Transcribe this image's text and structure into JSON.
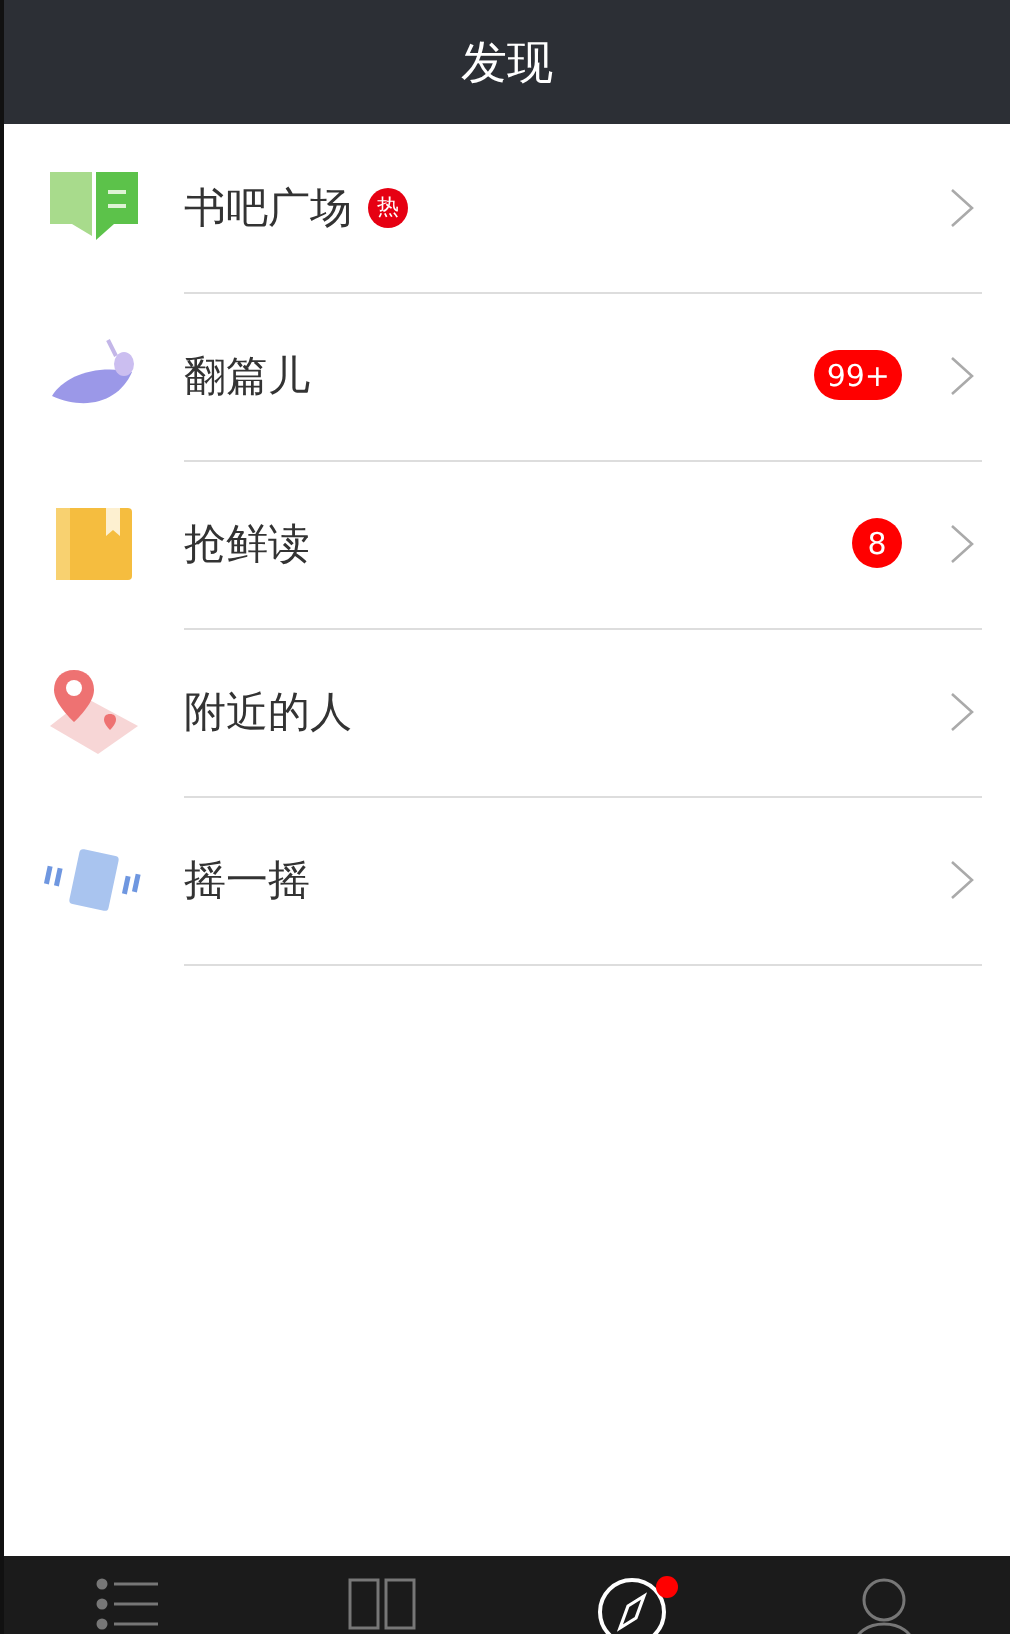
{
  "header": {
    "title": "发现"
  },
  "items": [
    {
      "title": "书吧广场",
      "kind": "book",
      "badge": {
        "kind": "hot",
        "text": "热"
      }
    },
    {
      "title": "翻篇儿",
      "kind": "feather",
      "badge": {
        "kind": "count",
        "text": "99+"
      }
    },
    {
      "title": "抢鲜读",
      "kind": "bookmark",
      "badge": {
        "kind": "count",
        "text": "8"
      }
    },
    {
      "title": "附近的人",
      "kind": "map"
    },
    {
      "title": "摇一摇",
      "kind": "shake"
    }
  ],
  "tabs": [
    {
      "kind": "list",
      "selected": false,
      "dot": false
    },
    {
      "kind": "book",
      "selected": false,
      "dot": false
    },
    {
      "kind": "compass",
      "selected": true,
      "dot": true
    },
    {
      "kind": "person",
      "selected": false,
      "dot": false
    }
  ]
}
